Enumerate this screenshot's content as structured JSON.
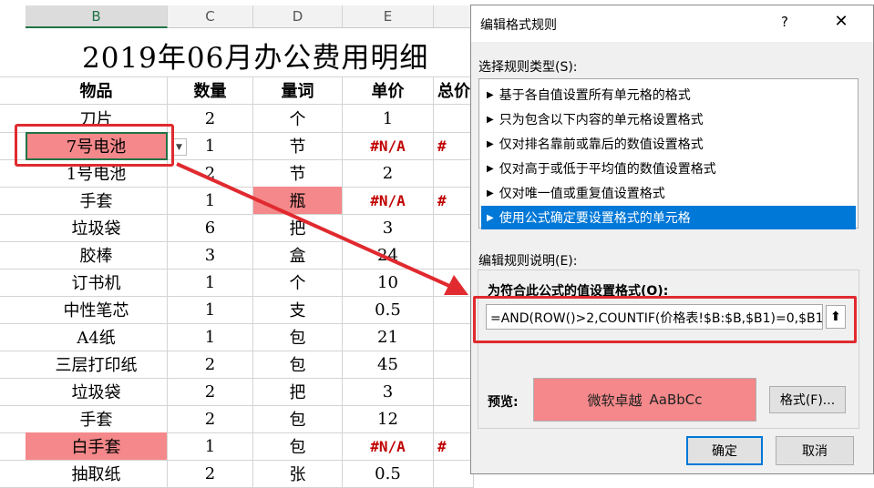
{
  "sheet": {
    "columns": [
      "B",
      "C",
      "D",
      "E"
    ],
    "title": "2019年06月办公费用明细",
    "header": [
      "物品",
      "数量",
      "量词",
      "单价",
      "总价"
    ],
    "rows": [
      {
        "item": "刀片",
        "qty": "2",
        "unit": "个",
        "price": "1",
        "total": ""
      },
      {
        "item": "7号电池",
        "qty": "1",
        "unit": "节",
        "price": "#N/A",
        "total": "#"
      },
      {
        "item": "1号电池",
        "qty": "2",
        "unit": "节",
        "price": "2",
        "total": ""
      },
      {
        "item": "手套",
        "qty": "1",
        "unit": "瓶",
        "price": "#N/A",
        "total": "#"
      },
      {
        "item": "垃圾袋",
        "qty": "6",
        "unit": "把",
        "price": "3",
        "total": ""
      },
      {
        "item": "胶棒",
        "qty": "3",
        "unit": "盒",
        "price": "24",
        "total": ""
      },
      {
        "item": "订书机",
        "qty": "1",
        "unit": "个",
        "price": "10",
        "total": ""
      },
      {
        "item": "中性笔芯",
        "qty": "1",
        "unit": "支",
        "price": "0.5",
        "total": ""
      },
      {
        "item": "A4纸",
        "qty": "1",
        "unit": "包",
        "price": "21",
        "total": ""
      },
      {
        "item": "三层打印纸",
        "qty": "2",
        "unit": "包",
        "price": "45",
        "total": ""
      },
      {
        "item": "垃圾袋",
        "qty": "2",
        "unit": "把",
        "price": "3",
        "total": ""
      },
      {
        "item": "手套",
        "qty": "2",
        "unit": "包",
        "price": "12",
        "total": ""
      },
      {
        "item": "白手套",
        "qty": "1",
        "unit": "包",
        "price": "#N/A",
        "total": "#"
      },
      {
        "item": "抽取纸",
        "qty": "2",
        "unit": "张",
        "price": "0.5",
        "total": ""
      }
    ],
    "highlight_color": "#f4888a"
  },
  "dialog": {
    "title": "编辑格式规则",
    "help": "?",
    "close": "✕",
    "select_type_label": "选择规则类型(S):",
    "rule_types": [
      "基于各自值设置所有单元格的格式",
      "只为包含以下内容的单元格设置格式",
      "仅对排名靠前或靠后的数值设置格式",
      "仅对高于或低于平均值的数值设置格式",
      "仅对唯一值或重复值设置格式",
      "使用公式确定要设置格式的单元格"
    ],
    "edit_desc_label": "编辑规则说明(E):",
    "formula_label": "为符合此公式的值设置格式(O):",
    "formula_value": "=AND(ROW()>2,COUNTIF(价格表!$B:$B,$B1)=0,$B1",
    "preview_label": "预览:",
    "preview_text": "微软卓越",
    "preview_sample": "AaBbCc",
    "format_button": "格式(F)...",
    "ok_button": "确定",
    "cancel_button": "取消",
    "selected_color": "#0078d7"
  }
}
